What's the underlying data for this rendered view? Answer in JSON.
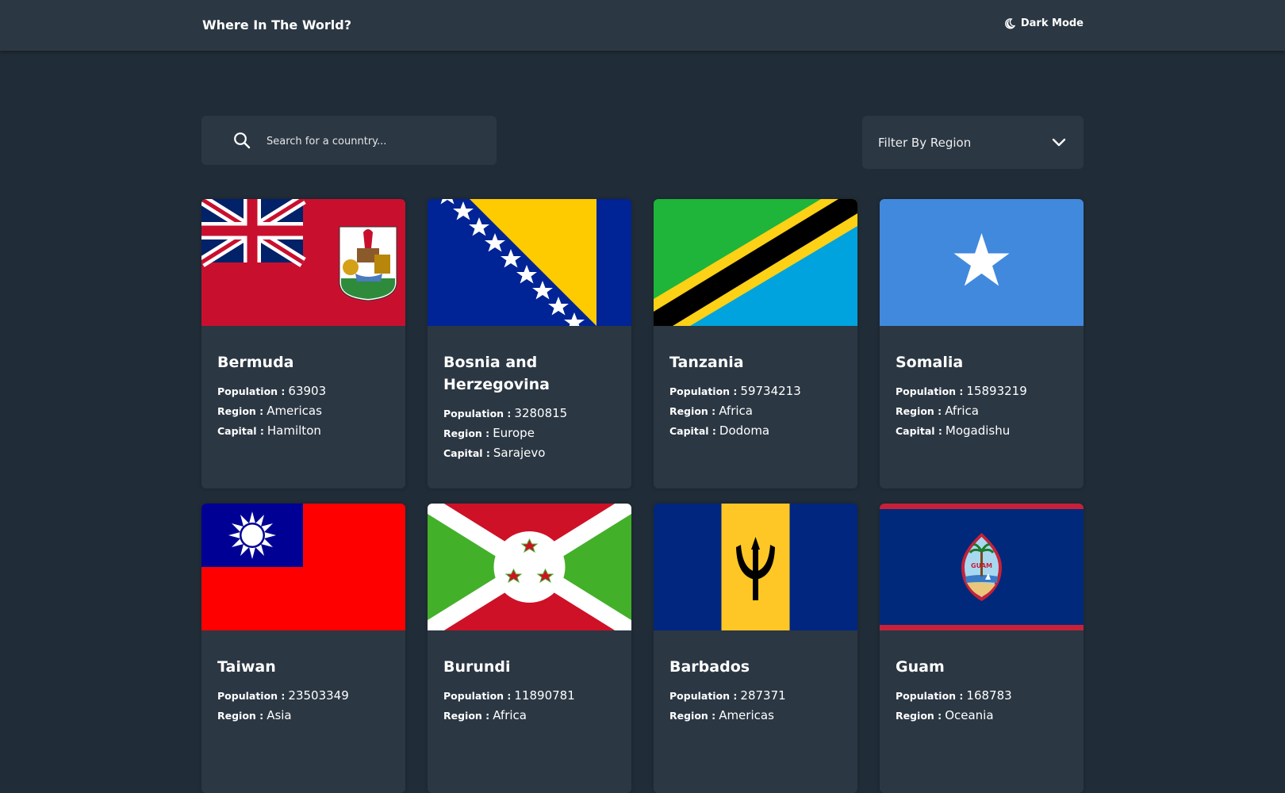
{
  "header": {
    "title": "Where In The World?",
    "mode_label": "Dark Mode"
  },
  "search": {
    "placeholder": "Search for a counntry..."
  },
  "filter": {
    "label": "Filter By Region"
  },
  "field_labels": {
    "population": "Population :",
    "region": "Region :",
    "capital": "Capital :"
  },
  "countries": [
    {
      "name": "Bermuda",
      "population": "63903",
      "region": "Americas",
      "capital": "Hamilton",
      "flag": "bermuda-flag-icon"
    },
    {
      "name": "Bosnia and Herzegovina",
      "population": "3280815",
      "region": "Europe",
      "capital": "Sarajevo",
      "flag": "bosnia-flag-icon"
    },
    {
      "name": "Tanzania",
      "population": "59734213",
      "region": "Africa",
      "capital": "Dodoma",
      "flag": "tanzania-flag-icon"
    },
    {
      "name": "Somalia",
      "population": "15893219",
      "region": "Africa",
      "capital": "Mogadishu",
      "flag": "somalia-flag-icon"
    },
    {
      "name": "Taiwan",
      "population": "23503349",
      "region": "Asia",
      "capital": "",
      "flag": "taiwan-flag-icon"
    },
    {
      "name": "Burundi",
      "population": "11890781",
      "region": "Africa",
      "capital": "",
      "flag": "burundi-flag-icon"
    },
    {
      "name": "Barbados",
      "population": "287371",
      "region": "Americas",
      "capital": "",
      "flag": "barbados-flag-icon"
    },
    {
      "name": "Guam",
      "population": "168783",
      "region": "Oceania",
      "capital": "",
      "flag": "guam-flag-icon"
    }
  ],
  "colors": {
    "background": "#202c37",
    "surface": "#2b3743",
    "text": "#ffffff"
  }
}
